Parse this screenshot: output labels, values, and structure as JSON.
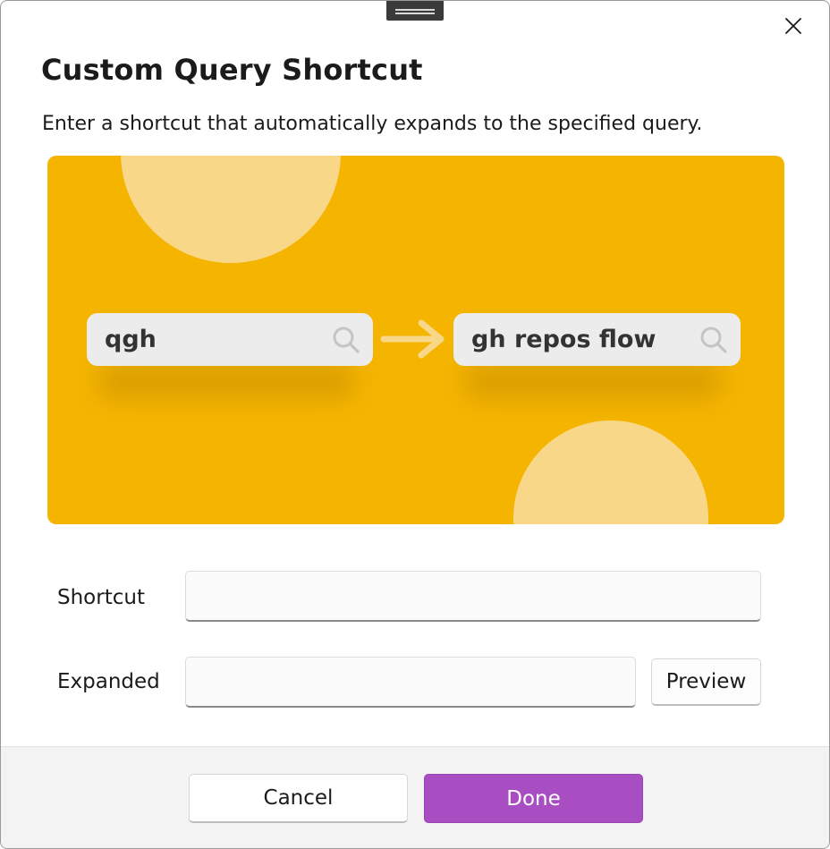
{
  "dialog": {
    "title": "Custom Query Shortcut",
    "description": "Enter a shortcut that automatically expands to the specified query.",
    "close_icon": "close-icon"
  },
  "illustration": {
    "background_color": "#f4b400",
    "shortcut_example": "qgh",
    "expanded_example": "gh repos flow",
    "search_icon": "search-icon",
    "arrow_icon": "arrow-right-icon"
  },
  "form": {
    "shortcut": {
      "label": "Shortcut",
      "value": "",
      "placeholder": ""
    },
    "expanded": {
      "label": "Expanded",
      "value": "",
      "placeholder": ""
    },
    "preview_label": "Preview"
  },
  "footer": {
    "cancel_label": "Cancel",
    "done_label": "Done",
    "accent_color": "#a84ec2"
  }
}
